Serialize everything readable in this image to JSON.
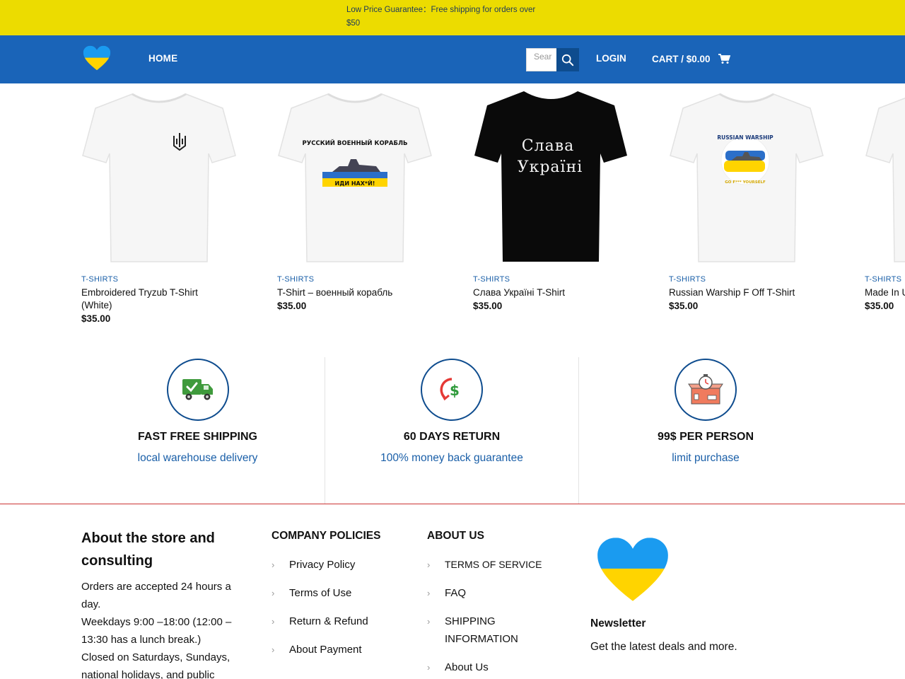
{
  "topbar": {
    "message_line1": "Low Price Guarantee：Free shipping for orders over",
    "message_line2": "$50"
  },
  "header": {
    "logo_icon": "heart-ukraine-flag-icon",
    "nav_home": "HOME",
    "search_placeholder": "Search",
    "search_value": "Sear",
    "login": "LOGIN",
    "cart": "CART / $0.00",
    "colors": {
      "topbar": "#ecdc00",
      "header": "#1a64b8",
      "search_button": "#0e4c8e"
    }
  },
  "products": [
    {
      "category": "T-SHIRTS",
      "name": "Embroidered Tryzub T-Shirt (White)",
      "price": "$35.00",
      "shirt_color": "white",
      "print": "tryzub"
    },
    {
      "category": "T-SHIRTS",
      "name": "T-Shirt – военный корабль",
      "price": "$35.00",
      "shirt_color": "white",
      "print": "warship",
      "print_text_top": "РУССКИЙ ВОЕННЫЙ КОРАБЛЬ",
      "print_text_bottom": "ИДИ НАХ*Й!"
    },
    {
      "category": "T-SHIRTS",
      "name": "Слава Україні T-Shirt",
      "price": "$35.00",
      "shirt_color": "black",
      "print": "text",
      "print_line1": "Слава",
      "print_line2": "Україні"
    },
    {
      "category": "T-SHIRTS",
      "name": "Russian Warship F Off T-Shirt",
      "price": "$35.00",
      "shirt_color": "white",
      "print": "badge",
      "print_text_top": "RUSSIAN WARSHIP",
      "print_text_bottom": "GO F*** YOURSELF"
    },
    {
      "category": "T-SHIRTS",
      "name": "Made In U",
      "price": "$35.00",
      "shirt_color": "white",
      "print": "none"
    }
  ],
  "features": [
    {
      "icon": "delivery-truck-icon",
      "title": "FAST FREE SHIPPING",
      "subtitle": "local warehouse delivery"
    },
    {
      "icon": "money-return-icon",
      "title": "60 DAYS RETURN",
      "subtitle": "100% money back guarantee"
    },
    {
      "icon": "package-timer-icon",
      "title": "99$ PER PERSON",
      "subtitle": "limit purchase"
    }
  ],
  "footer": {
    "about": {
      "title": "About the store and consulting",
      "text": "Orders are accepted 24 hours a day.\nWeekdays 9:00 –18:00 (12:00 – 13:30 has a lunch break.)\nClosed on Saturdays, Sundays, national holidays, and public"
    },
    "policies": {
      "title": "COMPANY POLICIES",
      "items": [
        "Privacy Policy",
        "Terms of Use",
        "Return & Refund",
        "About Payment"
      ]
    },
    "about_us": {
      "title": "ABOUT US",
      "items": [
        "TERMS OF SERVICE",
        "FAQ",
        "SHIPPING INFORMATION",
        "About Us"
      ]
    },
    "newsletter": {
      "title": "Newsletter",
      "subtitle": "Get the latest deals and more."
    }
  }
}
